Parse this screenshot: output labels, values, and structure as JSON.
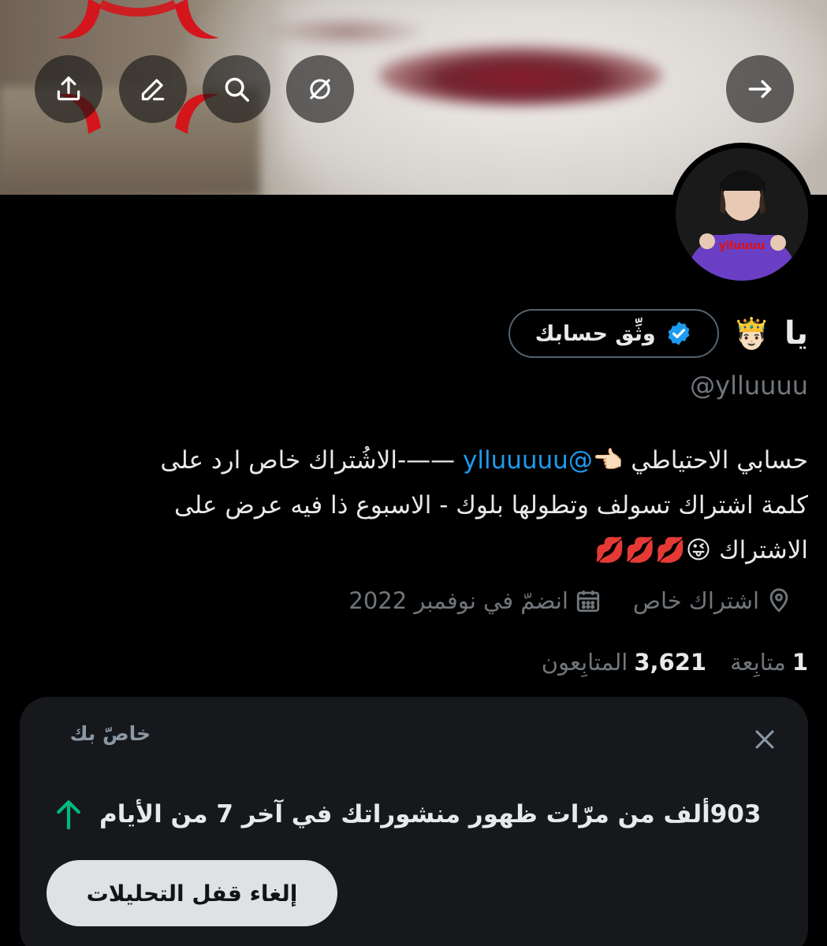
{
  "header": {
    "buttons": {
      "share_icon": "share-icon",
      "edit_icon": "edit-icon",
      "search_icon": "search-icon",
      "hide_icon": "eye-off-icon",
      "back_icon": "arrow-right-icon"
    }
  },
  "profile": {
    "display_name": "يا",
    "name_emoji": "🤴🏻",
    "verify_button_label": "وثِّق حسابك",
    "handle": "@ylluuuu",
    "bio": {
      "line1_prefix": "حسابي الاحتياطي",
      "pointing_emoji": "👈🏻",
      "mention": "@ylluuuuu",
      "line1_suffix": "——-الاشُتراك خاص ارد على",
      "line2": "كلمة اشتراك تسولف وتطولها بلوك - الاسبوع ذا فيه عرض على",
      "line3": "الاشتراك 😜💋💋💋"
    },
    "location": "اشتراك خاص",
    "joined": "انضمّ في نوفمبر 2022",
    "following_count": "1",
    "following_label": "متابِعة",
    "followers_count": "3,621",
    "followers_label": "المتابِعون"
  },
  "analytics_card": {
    "label": "خاصّ بك",
    "impressions_text": "903ألف من مرّات ظهور منشوراتك في آخر 7 من الأيام",
    "trend": "up",
    "unlock_button_label": "إلغاء قفل التحليلات"
  },
  "colors": {
    "background": "#000000",
    "text_primary": "#e7e9ea",
    "text_secondary": "#71767b",
    "mention": "#1d9bf0",
    "verified_badge": "#1d9bf0",
    "trend_up": "#00ba7c",
    "card_background": "#16181c",
    "unlock_button_bg": "#dfe1e3"
  }
}
